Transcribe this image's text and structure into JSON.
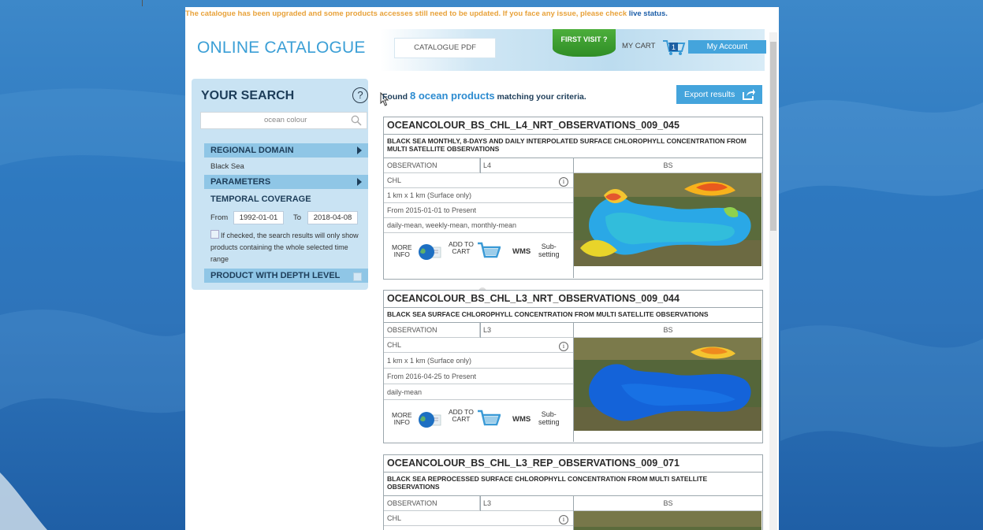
{
  "notice": {
    "text": "The catalogue has been upgraded and some products accesses still need to be updated. If you face any issue, please check ",
    "link": "live status."
  },
  "header": {
    "title": "ONLINE CATALOGUE",
    "catalogue_pdf": "CATALOGUE PDF",
    "first_visit": "FIRST VISIT ?",
    "my_cart": "MY CART",
    "cart_count": "1",
    "my_account": "My Account"
  },
  "search": {
    "title": "YOUR SEARCH",
    "help": "?",
    "query": "ocean colour",
    "regional_domain": "REGIONAL DOMAIN",
    "regional_value": "Black Sea",
    "parameters": "PARAMETERS",
    "temporal_coverage": "TEMPORAL COVERAGE",
    "from_label": "From",
    "from_value": "1992-01-01",
    "to_label": "To",
    "to_value": "2018-04-08",
    "checkbox_text": "If checked, the search results will only show products containing the whole selected time range",
    "depth_level": "PRODUCT WITH DEPTH LEVEL"
  },
  "results": {
    "found_prefix": "Found ",
    "found_count": "8 ocean products",
    "found_suffix": " matching your criteria.",
    "export": "Export results"
  },
  "actions": {
    "more_info_1": "MORE",
    "more_info_2": "INFO",
    "add_cart_1": "ADD TO",
    "add_cart_2": "CART",
    "wms": "WMS",
    "sub_1": "Sub-",
    "sub_2": "setting"
  },
  "products": [
    {
      "id": "OCEANCOLOUR_BS_CHL_L4_NRT_OBSERVATIONS_009_045",
      "description": "BLACK SEA MONTHLY, 8-DAYS AND DAILY INTERPOLATED SURFACE CHLOROPHYLL CONCENTRATION FROM MULTI SATELLITE OBSERVATIONS",
      "type": "OBSERVATION",
      "level": "L4",
      "area": "BS",
      "variable": "CHL",
      "resolution": "1 km x 1 km (Surface only)",
      "coverage": "From 2015-01-01 to Present",
      "temporal": "daily-mean, weekly-mean, monthly-mean"
    },
    {
      "id": "OCEANCOLOUR_BS_CHL_L3_NRT_OBSERVATIONS_009_044",
      "description": "BLACK SEA SURFACE CHLOROPHYLL CONCENTRATION FROM MULTI SATELLITE OBSERVATIONS",
      "type": "OBSERVATION",
      "level": "L3",
      "area": "BS",
      "variable": "CHL",
      "resolution": "1 km x 1 km (Surface only)",
      "coverage": "From 2016-04-25 to Present",
      "temporal": "daily-mean"
    },
    {
      "id": "OCEANCOLOUR_BS_CHL_L3_REP_OBSERVATIONS_009_071",
      "description": "BLACK SEA REPROCESSED SURFACE CHLOROPHYLL CONCENTRATION FROM MULTI SATELLITE OBSERVATIONS",
      "type": "OBSERVATION",
      "level": "L3",
      "area": "BS",
      "variable": "CHL"
    }
  ]
}
